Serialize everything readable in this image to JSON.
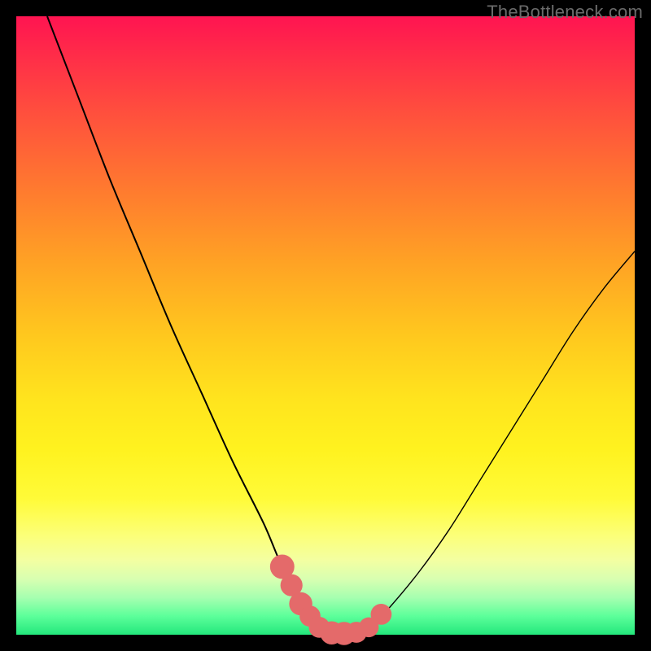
{
  "watermark": "TheBottleneck.com",
  "chart_data": {
    "type": "line",
    "title": "",
    "xlabel": "",
    "ylabel": "",
    "xlim": [
      0,
      100
    ],
    "ylim": [
      0,
      100
    ],
    "grid": false,
    "legend": false,
    "background_gradient": [
      "#ff1451",
      "#ff7a2f",
      "#ffe41e",
      "#23e77c"
    ],
    "series": [
      {
        "name": "left-curve",
        "x": [
          5,
          10,
          15,
          20,
          25,
          30,
          35,
          40,
          43,
          46,
          48,
          50,
          52
        ],
        "y": [
          100,
          87,
          74,
          62,
          50,
          39,
          28,
          18,
          11,
          6,
          3,
          1,
          0
        ]
      },
      {
        "name": "right-curve",
        "x": [
          55,
          57,
          60,
          65,
          70,
          75,
          80,
          85,
          90,
          95,
          100
        ],
        "y": [
          0,
          1,
          4,
          10,
          17,
          25,
          33,
          41,
          49,
          56,
          62
        ]
      }
    ],
    "markers": {
      "name": "highlight-zone",
      "color": "#e46a6a",
      "points": [
        {
          "x": 43,
          "y": 11,
          "r": 1.6
        },
        {
          "x": 44.5,
          "y": 8,
          "r": 1.4
        },
        {
          "x": 46,
          "y": 5,
          "r": 1.5
        },
        {
          "x": 47.5,
          "y": 3,
          "r": 1.3
        },
        {
          "x": 49,
          "y": 1.2,
          "r": 1.3
        },
        {
          "x": 51,
          "y": 0.3,
          "r": 1.5
        },
        {
          "x": 53,
          "y": 0.2,
          "r": 1.5
        },
        {
          "x": 55,
          "y": 0.4,
          "r": 1.3
        },
        {
          "x": 57,
          "y": 1.2,
          "r": 1.2
        },
        {
          "x": 59,
          "y": 3.3,
          "r": 1.3
        }
      ]
    }
  }
}
